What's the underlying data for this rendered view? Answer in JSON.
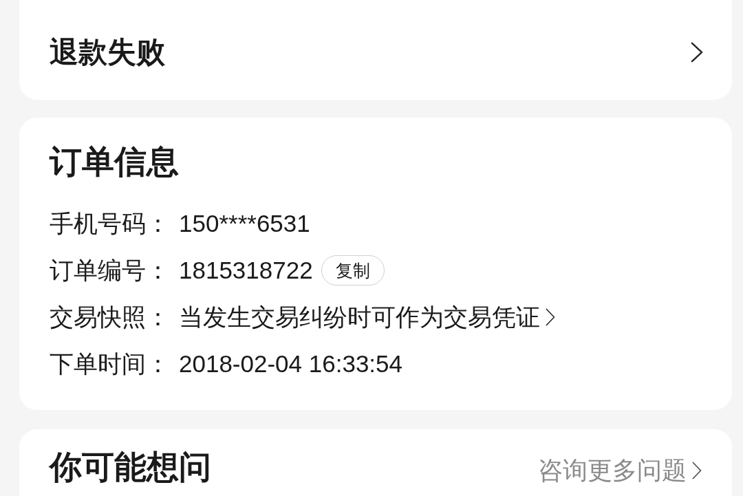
{
  "refund_status": {
    "title": "退款失败"
  },
  "order_info": {
    "title": "订单信息",
    "fields": [
      {
        "kind": "text",
        "label": "手机号码：",
        "value": "150****6531"
      },
      {
        "kind": "copy",
        "label": "订单编号：",
        "value": "1815318722",
        "action": "复制"
      },
      {
        "kind": "link",
        "label": "交易快照：",
        "value": "当发生交易纠纷时可作为交易凭证"
      },
      {
        "kind": "text",
        "label": "下单时间：",
        "value": "2018-02-04 16:33:54"
      }
    ]
  },
  "faq": {
    "title": "你可能想问",
    "more_link": "咨询更多问题"
  }
}
